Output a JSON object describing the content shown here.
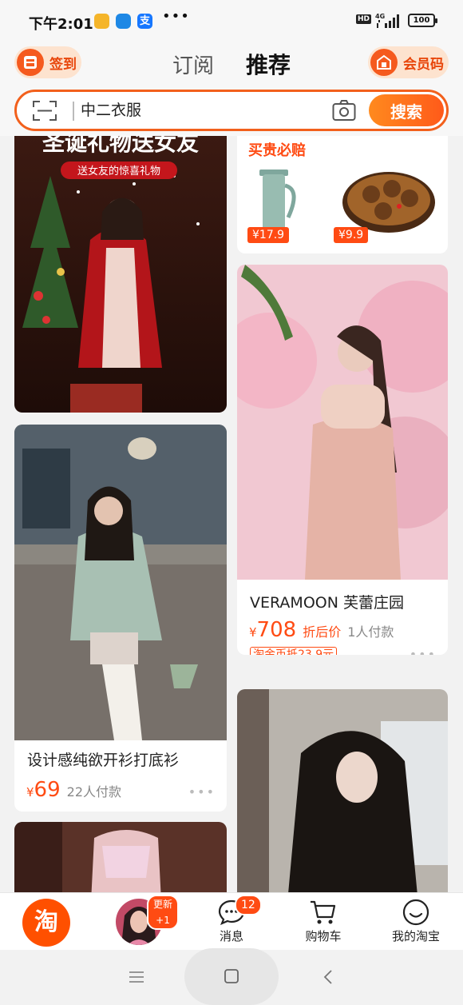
{
  "status_bar": {
    "time": "下午2:01",
    "hd": "HD",
    "network": "4G",
    "battery": "100"
  },
  "header": {
    "checkin_label": "签到",
    "tabs": [
      {
        "label": "订阅"
      },
      {
        "label": "推荐"
      }
    ],
    "member_label": "会员码",
    "search": {
      "value": "中二衣服",
      "button": "搜索"
    }
  },
  "feed": {
    "left": [
      {
        "kind": "image",
        "banner_title": "圣诞礼物送女友",
        "banner_tag": "送女友的惊喜礼物"
      },
      {
        "kind": "product",
        "title": "设计感纯欲开衫打底衫",
        "price_prefix": "¥",
        "price": "69",
        "buyers": "22人付款",
        "more": "•••"
      },
      {
        "kind": "image"
      }
    ],
    "right": [
      {
        "kind": "promo",
        "title": "买贵必赔",
        "prices": [
          "¥17.9",
          "¥9.9"
        ]
      },
      {
        "kind": "product",
        "title": "VERAMOON 芙蕾庄园",
        "price_prefix": "¥",
        "price": "708",
        "price_label": "折后价",
        "buyers": "1人付款",
        "coupon": "淘金币抵23.9元",
        "more": "•••"
      },
      {
        "kind": "image"
      }
    ]
  },
  "tabbar": {
    "home_logo": "淘",
    "update_badge": "更新+1",
    "items": [
      {
        "label": "消息",
        "badge": "12"
      },
      {
        "label": "购物车"
      },
      {
        "label": "我的淘宝"
      }
    ]
  },
  "colors": {
    "accent": "#ff4b13",
    "search_border": "#f2601c"
  }
}
